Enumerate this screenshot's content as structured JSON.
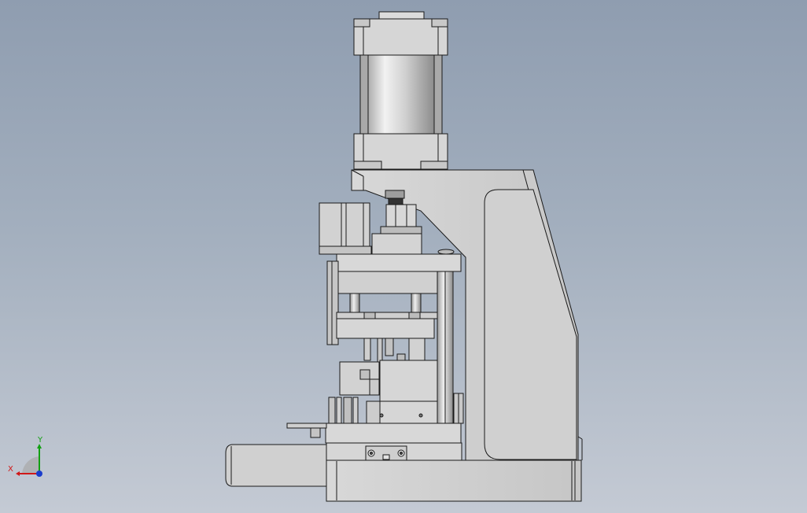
{
  "viewport": {
    "background_top": "#8f9db0",
    "background_bottom": "#c4cad4"
  },
  "model": {
    "colors": {
      "body": "#d4d4d4",
      "body_light": "#e6e6e6",
      "body_dark": "#a8a8a8",
      "steel": "#bdbdbd",
      "edge": "#1a1a1a"
    }
  },
  "triad": {
    "x_label": "X",
    "y_label": "Y",
    "x_color": "#d01818",
    "y_color": "#12a012",
    "z_color": "#1a3ccc"
  }
}
